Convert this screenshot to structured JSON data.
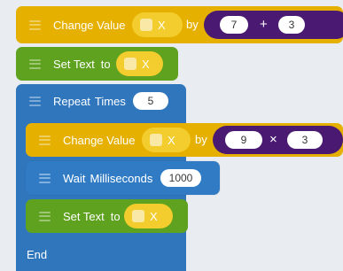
{
  "blocks": {
    "change_value_1": {
      "label": "Change Value",
      "variable": "X",
      "by": "by",
      "left": "7",
      "operator": "+",
      "right": "3"
    },
    "set_text_1": {
      "label": "Set Text",
      "to": "to",
      "variable": "X"
    },
    "repeat": {
      "label": "Repeat",
      "times": "Times",
      "count": "5"
    },
    "change_value_2": {
      "label": "Change Value",
      "variable": "X",
      "by": "by",
      "left": "9",
      "operator": "×",
      "right": "3"
    },
    "wait": {
      "label": "Wait",
      "unit": "Milliseconds",
      "value": "1000"
    },
    "set_text_2": {
      "label": "Set Text",
      "to": "to",
      "variable": "X"
    },
    "end": {
      "label": "End"
    }
  },
  "colors": {
    "control": "#2f76bd",
    "variable": "#e6b000",
    "text": "#5fa21f",
    "math": "#4a1a73"
  }
}
